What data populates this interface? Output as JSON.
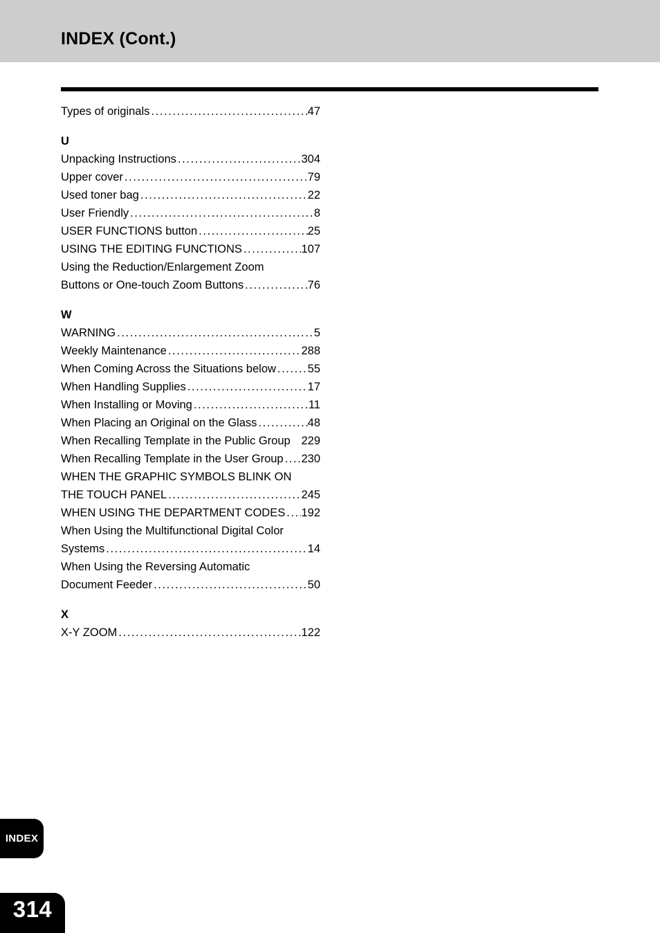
{
  "header": {
    "title": "INDEX (Cont.)",
    "band_color": "#cdcdcd",
    "rule_color": "#000000"
  },
  "index": {
    "leader_char": ".",
    "sections": [
      {
        "letter": "",
        "show_letter": false,
        "entries": [
          {
            "label": "Types of originals",
            "leader": true,
            "page": "47",
            "lines": []
          }
        ]
      },
      {
        "letter": "U",
        "show_letter": true,
        "entries": [
          {
            "label": "Unpacking Instructions",
            "leader": true,
            "page": "304",
            "lines": []
          },
          {
            "label": "Upper cover",
            "leader": true,
            "page": "79",
            "lines": []
          },
          {
            "label": "Used toner bag",
            "leader": true,
            "page": "22",
            "lines": []
          },
          {
            "label": "User Friendly",
            "leader": true,
            "page": "8",
            "lines": []
          },
          {
            "label": "USER FUNCTIONS button",
            "leader": true,
            "page": "25",
            "lines": []
          },
          {
            "label": "USING THE EDITING FUNCTIONS",
            "leader": true,
            "page": "107",
            "lines": []
          },
          {
            "label": "Buttons or One-touch Zoom Buttons",
            "leader": true,
            "page": "76",
            "lines": [
              "Using the Reduction/Enlargement Zoom"
            ]
          }
        ]
      },
      {
        "letter": "W",
        "show_letter": true,
        "entries": [
          {
            "label": "WARNING",
            "leader": true,
            "page": "5",
            "lines": []
          },
          {
            "label": "Weekly Maintenance",
            "leader": true,
            "page": "288",
            "lines": []
          },
          {
            "label": "When Coming Across the Situations below",
            "leader": true,
            "page": "55",
            "lines": []
          },
          {
            "label": "When Handling Supplies",
            "leader": true,
            "page": "17",
            "lines": []
          },
          {
            "label": "When Installing or Moving",
            "leader": true,
            "page": "11",
            "lines": []
          },
          {
            "label": "When Placing an Original on the Glass",
            "leader": true,
            "page": "48",
            "lines": []
          },
          {
            "label": "When Recalling Template in the Public Group",
            "leader": false,
            "page": "229",
            "lines": []
          },
          {
            "label": "When Recalling Template in the User Group",
            "leader": true,
            "page": "230",
            "lines": []
          },
          {
            "label": "THE TOUCH PANEL",
            "leader": true,
            "page": "245",
            "lines": [
              "WHEN THE GRAPHIC SYMBOLS BLINK ON"
            ]
          },
          {
            "label": "WHEN USING THE DEPARTMENT CODES",
            "leader": true,
            "page": "192",
            "lines": []
          },
          {
            "label": "Systems",
            "leader": true,
            "page": "14",
            "lines": [
              "When Using the Multifunctional Digital Color"
            ]
          },
          {
            "label": "Document Feeder",
            "leader": true,
            "page": "50",
            "lines": [
              "When Using the Reversing Automatic"
            ]
          }
        ]
      },
      {
        "letter": "X",
        "show_letter": true,
        "entries": [
          {
            "label": "X-Y ZOOM",
            "leader": true,
            "page": "122",
            "lines": []
          }
        ]
      }
    ]
  },
  "footer": {
    "tab_label": "INDEX",
    "page_number": "314",
    "tab_color": "#000000",
    "tab_text_color": "#ffffff"
  }
}
